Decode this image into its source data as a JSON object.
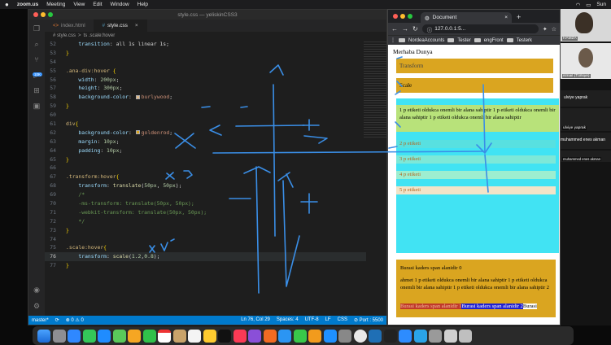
{
  "menubar": {
    "apple": "",
    "app": "zoom.us",
    "items": [
      "Meeting",
      "View",
      "Edit",
      "Window",
      "Help"
    ],
    "clock": "Sun"
  },
  "vscode": {
    "title": "style.css — yeliskinCSS3",
    "tabs": [
      {
        "label": "index.html",
        "icon": "<>",
        "active": false
      },
      {
        "label": "style.css",
        "icon": "#",
        "active": true
      }
    ],
    "breadcrumb": [
      "# style.css",
      ">",
      "ts .scale:hover"
    ],
    "badge": "10K",
    "lines": [
      {
        "n": "52",
        "segs": [
          [
            "code",
            "    "
          ],
          [
            "prop",
            "transition"
          ],
          [
            "code",
            ": all 1s linear 1s;"
          ]
        ]
      },
      {
        "n": "53",
        "segs": [
          [
            "br",
            "}"
          ]
        ]
      },
      {
        "n": "54",
        "segs": []
      },
      {
        "n": "55",
        "segs": [
          [
            "sel",
            ".ana-div:hover"
          ],
          [
            "code",
            " "
          ],
          [
            "br",
            "{"
          ]
        ]
      },
      {
        "n": "56",
        "segs": [
          [
            "code",
            "    "
          ],
          [
            "prop",
            "width"
          ],
          [
            "code",
            ": "
          ],
          [
            "num",
            "200px"
          ],
          [
            "code",
            ";"
          ]
        ]
      },
      {
        "n": "57",
        "segs": [
          [
            "code",
            "    "
          ],
          [
            "prop",
            "height"
          ],
          [
            "code",
            ": "
          ],
          [
            "num",
            "300px"
          ],
          [
            "code",
            ";"
          ]
        ]
      },
      {
        "n": "58",
        "segs": [
          [
            "code",
            "    "
          ],
          [
            "prop",
            "background-color"
          ],
          [
            "code",
            ": "
          ],
          [
            "sw1",
            ""
          ],
          [
            "val",
            "burlywood"
          ],
          [
            "code",
            ";"
          ]
        ]
      },
      {
        "n": "59",
        "segs": [
          [
            "br",
            "}"
          ]
        ]
      },
      {
        "n": "60",
        "segs": []
      },
      {
        "n": "61",
        "segs": [
          [
            "sel",
            "div"
          ],
          [
            "br",
            "{"
          ]
        ]
      },
      {
        "n": "62",
        "segs": [
          [
            "code",
            "    "
          ],
          [
            "prop",
            "background-color"
          ],
          [
            "code",
            ": "
          ],
          [
            "sw2",
            ""
          ],
          [
            "val",
            "goldenrod"
          ],
          [
            "code",
            ";"
          ]
        ]
      },
      {
        "n": "63",
        "segs": [
          [
            "code",
            "    "
          ],
          [
            "prop",
            "margin"
          ],
          [
            "code",
            ": "
          ],
          [
            "num",
            "10px"
          ],
          [
            "code",
            ";"
          ]
        ]
      },
      {
        "n": "64",
        "segs": [
          [
            "code",
            "    "
          ],
          [
            "prop",
            "padding"
          ],
          [
            "code",
            ": "
          ],
          [
            "num",
            "10px"
          ],
          [
            "code",
            ";"
          ]
        ]
      },
      {
        "n": "65",
        "segs": [
          [
            "br",
            "}"
          ]
        ]
      },
      {
        "n": "66",
        "segs": []
      },
      {
        "n": "67",
        "segs": [
          [
            "sel",
            ".transform:hover"
          ],
          [
            "br",
            "{"
          ]
        ]
      },
      {
        "n": "68",
        "segs": [
          [
            "code",
            "    "
          ],
          [
            "prop",
            "transform"
          ],
          [
            "code",
            ": "
          ],
          [
            "fn",
            "translate"
          ],
          [
            "code",
            "("
          ],
          [
            "num",
            "50px"
          ],
          [
            "code",
            ", "
          ],
          [
            "num",
            "50px"
          ],
          [
            "code",
            ");"
          ]
        ]
      },
      {
        "n": "69",
        "segs": [
          [
            "cm",
            "    /*"
          ]
        ]
      },
      {
        "n": "70",
        "segs": [
          [
            "cm",
            "    -ms-transform: translate(50px, 50px);"
          ]
        ]
      },
      {
        "n": "71",
        "segs": [
          [
            "cm",
            "    -webkit-transform: translate(50px, 50px);"
          ]
        ]
      },
      {
        "n": "72",
        "segs": [
          [
            "cm",
            "    */"
          ]
        ]
      },
      {
        "n": "73",
        "segs": [
          [
            "br",
            "}"
          ]
        ]
      },
      {
        "n": "74",
        "segs": []
      },
      {
        "n": "75",
        "segs": [
          [
            "sel",
            ".scale:hover"
          ],
          [
            "br",
            "{"
          ]
        ]
      },
      {
        "n": "76",
        "segs": [
          [
            "code",
            "    "
          ],
          [
            "prop",
            "transform"
          ],
          [
            "code",
            ": "
          ],
          [
            "fn",
            "scale"
          ],
          [
            "code",
            "("
          ],
          [
            "num",
            "1.2"
          ],
          [
            "code",
            ","
          ],
          [
            "num",
            "0.8"
          ],
          [
            "code",
            ");"
          ]
        ],
        "current": true
      },
      {
        "n": "77",
        "segs": [
          [
            "br",
            "}"
          ]
        ]
      }
    ],
    "status": {
      "branch": "master*",
      "sync": "⟳",
      "problems": "⊗ 0 ⚠ 0",
      "position": "Ln 76, Col 29",
      "spaces": "Spaces: 4",
      "encoding": "UTF-8",
      "eol": "LF",
      "lang": "CSS",
      "port": "⊘ Port : 5500"
    }
  },
  "chrome": {
    "tab_title": "Document",
    "url": "127.0.0.1:5...",
    "bookmarks": [
      "NordeaAccounts",
      "Tester",
      "engFront",
      "Testerk"
    ],
    "page": {
      "heading": "Merhaba Dunya",
      "transform": "Transform",
      "scale": "Scale",
      "p1": "1 p etiketi oldukca onemli bir alana sahiptir 1 p etiketi oldukca onemli bir alana sahiptir 1 p etiketi oldukca onemli bir alana sahiptir",
      "p2": "2 p etiketi",
      "p3": "3 p etiketi",
      "p4": "4 p etiketi",
      "p5": "5 p etiketi",
      "span0": "Burasi kaders span alanidir 0",
      "ahmet": "ahmet 1 p etiketi oldukca onemli bir alana sahiptir 1 p etiketi oldukca onemli bir alana sahiptir 1 p etiketi oldukca onemli bir alana sahiptir 2",
      "span1": "Burasi kaders span alanidir 1",
      "span2": "Burasi kaders span alanidir 2",
      "span3": "Burasi"
    }
  },
  "participants": [
    {
      "name": "HAMZA"
    },
    {
      "name": "ismail (Türkiye)"
    },
    {
      "name": "ulviye yaprak"
    },
    {
      "name": "ulviye yaprak"
    },
    {
      "name": "muhammed enes akman"
    },
    {
      "name": "muhammed enes akman"
    }
  ],
  "colors": {
    "goldenrod": "#daa520",
    "burlywood": "#deb887",
    "pen": "#3a8ee6",
    "teal": "#41e3f3"
  }
}
